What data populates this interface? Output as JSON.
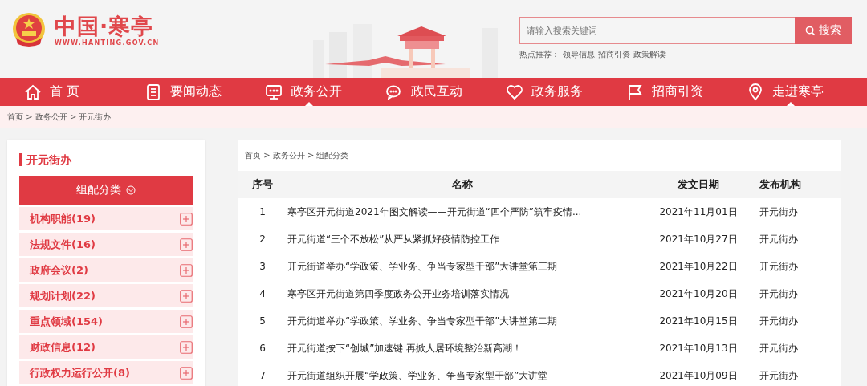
{
  "site": {
    "title": "中国·寒亭",
    "url": "WWW.HANTING.GOV.CN"
  },
  "search": {
    "placeholder": "请输入搜索关键词",
    "button": "搜索",
    "hot_label": "热点推荐：",
    "hot_links": [
      "领导信息",
      "招商引资",
      "政策解读"
    ]
  },
  "nav": [
    {
      "label": "首 页",
      "selected": false
    },
    {
      "label": "要闻动态",
      "selected": false
    },
    {
      "label": "政务公开",
      "selected": true
    },
    {
      "label": "政民互动",
      "selected": false
    },
    {
      "label": "政务服务",
      "selected": false
    },
    {
      "label": "招商引资",
      "selected": false
    },
    {
      "label": "走进寒亭",
      "selected": true
    }
  ],
  "breadcrumb": "首页 > 政务公开 > 开元街办",
  "sidebar": {
    "title": "开元街办",
    "header": "组配分类",
    "items": [
      "机构职能(19)",
      "法规文件(16)",
      "政府会议(2)",
      "规划计划(22)",
      "重点领域(154)",
      "财政信息(12)",
      "行政权力运行公开(8)"
    ]
  },
  "main": {
    "breadcrumb": "首页 > 政务公开 > 组配分类",
    "table": {
      "columns": [
        "序号",
        "名称",
        "发文日期",
        "发布机构"
      ],
      "rows": [
        [
          "1",
          "寒亭区开元街道2021年图文解读——开元街道“四个严防”筑牢疫情...",
          "2021年11月01日",
          "开元街办"
        ],
        [
          "2",
          "开元街道“三个不放松”从严从紧抓好疫情防控工作",
          "2021年10月27日",
          "开元街办"
        ],
        [
          "3",
          "开元街道举办“学政策、学业务、争当专家型干部”大讲堂第三期",
          "2021年10月22日",
          "开元街办"
        ],
        [
          "4",
          "寒亭区开元街道第四季度政务公开业务培训落实情况",
          "2021年10月20日",
          "开元街办"
        ],
        [
          "5",
          "开元街道举办“学政策、学业务、争当专家型干部”大讲堂第二期",
          "2021年10月15日",
          "开元街办"
        ],
        [
          "6",
          "开元街道按下“创城”加速键 再掀人居环境整治新高潮！",
          "2021年10月13日",
          "开元街办"
        ],
        [
          "7",
          "开元街道组织开展“学政策、学业务、争当专家型干部”大讲堂",
          "2021年10月09日",
          "开元街办"
        ]
      ]
    }
  }
}
